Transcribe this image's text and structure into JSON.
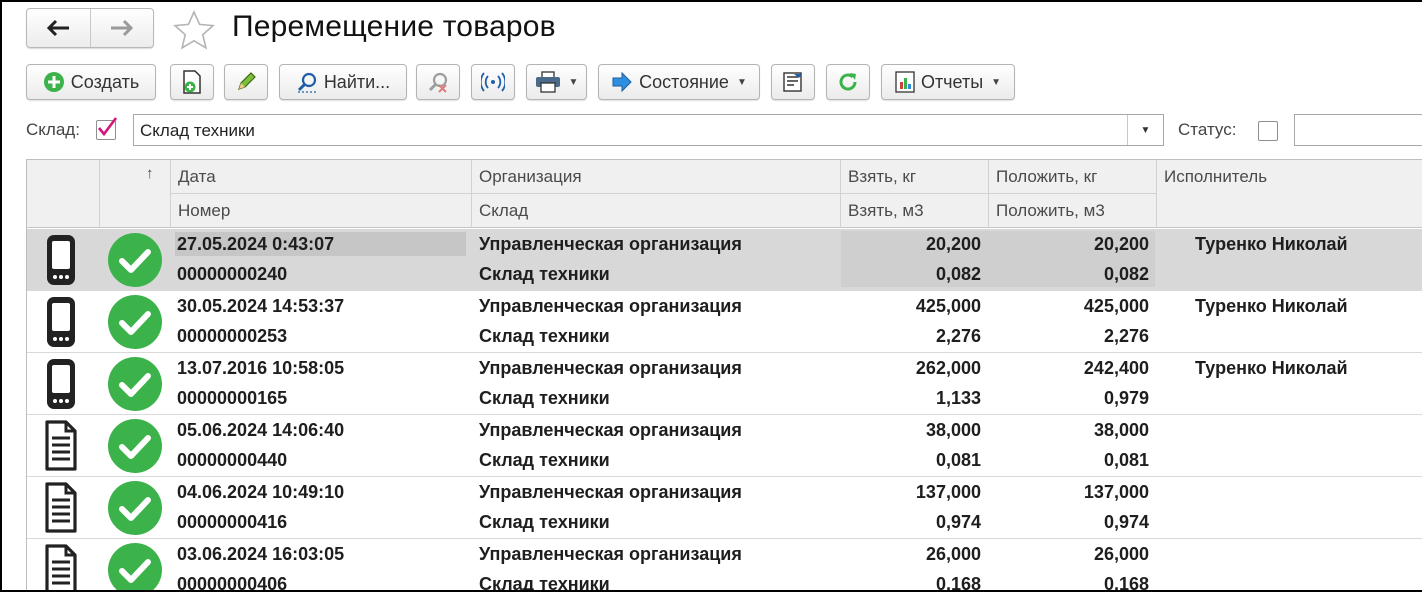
{
  "window": {
    "title": "Перемещение товаров",
    "icons": {
      "back": "arrow-left-icon",
      "forward": "arrow-right-icon",
      "favorite": "star-icon"
    }
  },
  "toolbar": {
    "create_label": "Создать",
    "find_label": "Найти...",
    "state_label": "Состояние",
    "reports_label": "Отчеты",
    "icons": [
      "plus-circle-icon",
      "copy-doc-icon",
      "pencil-icon",
      "magnifier-icon",
      "cancel-search-icon",
      "radio-wave-icon",
      "printer-icon",
      "arrow-right-icon",
      "filter-doc-icon",
      "refresh-icon",
      "chart-icon"
    ]
  },
  "filters": {
    "warehouse_label": "Склад:",
    "warehouse_checked": true,
    "warehouse_value": "Склад техники",
    "status_label": "Статус:",
    "status_checked": false,
    "status_value": ""
  },
  "table": {
    "sort_indicator": "↑",
    "headers": {
      "date": "Дата",
      "number": "Номер",
      "organization": "Организация",
      "warehouse": "Склад",
      "take_kg": "Взять, кг",
      "take_m3": "Взять, м3",
      "put_kg": "Положить, кг",
      "put_m3": "Положить, м3",
      "executor": "Исполнитель"
    },
    "rows": [
      {
        "icon": "mobile-device-icon",
        "status": "check-circle-icon",
        "date": "27.05.2024 0:43:07",
        "number": "00000000240",
        "organization": "Управленческая организация",
        "warehouse": "Склад техники",
        "take_kg": "20,200",
        "take_m3": "0,082",
        "put_kg": "20,200",
        "put_m3": "0,082",
        "executor": "Туренко Николай",
        "selected": true
      },
      {
        "icon": "mobile-device-icon",
        "status": "check-circle-icon",
        "date": "30.05.2024 14:53:37",
        "number": "00000000253",
        "organization": "Управленческая организация",
        "warehouse": "Склад техники",
        "take_kg": "425,000",
        "take_m3": "2,276",
        "put_kg": "425,000",
        "put_m3": "2,276",
        "executor": "Туренко Николай",
        "selected": false
      },
      {
        "icon": "mobile-device-icon",
        "status": "check-circle-icon",
        "date": "13.07.2016 10:58:05",
        "number": "00000000165",
        "organization": "Управленческая организация",
        "warehouse": "Склад техники",
        "take_kg": "262,000",
        "take_m3": "1,133",
        "put_kg": "242,400",
        "put_m3": "0,979",
        "executor": "Туренко Николай",
        "selected": false
      },
      {
        "icon": "document-icon",
        "status": "check-circle-icon",
        "date": "05.06.2024 14:06:40",
        "number": "00000000440",
        "organization": "Управленческая организация",
        "warehouse": "Склад техники",
        "take_kg": "38,000",
        "take_m3": "0,081",
        "put_kg": "38,000",
        "put_m3": "0,081",
        "executor": "",
        "selected": false
      },
      {
        "icon": "document-icon",
        "status": "check-circle-icon",
        "date": "04.06.2024 10:49:10",
        "number": "00000000416",
        "organization": "Управленческая организация",
        "warehouse": "Склад техники",
        "take_kg": "137,000",
        "take_m3": "0,974",
        "put_kg": "137,000",
        "put_m3": "0,974",
        "executor": "",
        "selected": false
      },
      {
        "icon": "document-icon",
        "status": "check-circle-icon",
        "date": "03.06.2024 16:03:05",
        "number": "00000000406",
        "organization": "Управленческая организация",
        "warehouse": "Склад техники",
        "take_kg": "26,000",
        "take_m3": "0,168",
        "put_kg": "26,000",
        "put_m3": "0,168",
        "executor": "",
        "selected": false
      }
    ]
  },
  "colors": {
    "ok_green": "#3cb34a",
    "selection": "#d8d8d8",
    "checkmark_pink": "#d6157a",
    "accent_blue": "#1f78d1"
  }
}
